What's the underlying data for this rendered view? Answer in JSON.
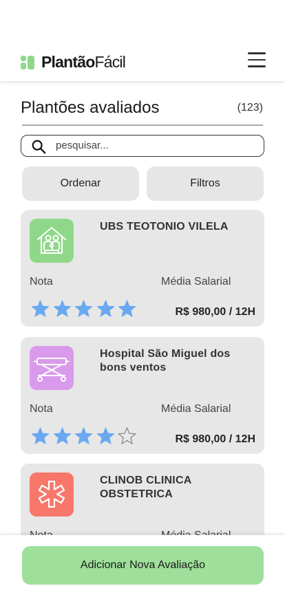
{
  "header": {
    "logo_bold": "Plantão",
    "logo_regular": "Fácil"
  },
  "main": {
    "title": "Plantões avaliados",
    "count": "(123)",
    "search": {
      "placeholder": "pesquisar..."
    },
    "order_label": "Ordenar",
    "filters_label": "Filtros",
    "nota_label": "Nota",
    "media_label": "Média Salarial",
    "cards": [
      {
        "name": "UBS TEOTONIO VILELA",
        "price": "R$ 980,00 / 12H",
        "rating": 5,
        "icon": "family-house-icon",
        "color": "#8fd88a"
      },
      {
        "name": "Hospital São Miguel dos bons ventos",
        "price": "R$ 980,00 / 12H",
        "rating": 4,
        "icon": "stretcher-icon",
        "color": "#d99aeb"
      },
      {
        "name": "CLINOB CLINICA OBSTETRICA",
        "price": "",
        "rating": 0,
        "icon": "medical-star-icon",
        "color": "#f7776b"
      }
    ]
  },
  "footer": {
    "add_label": "Adicionar Nova Avaliação"
  },
  "colors": {
    "accent_green": "#9ee09a",
    "star_blue": "#6aa9f0",
    "card_bg": "#e7e7e7"
  }
}
